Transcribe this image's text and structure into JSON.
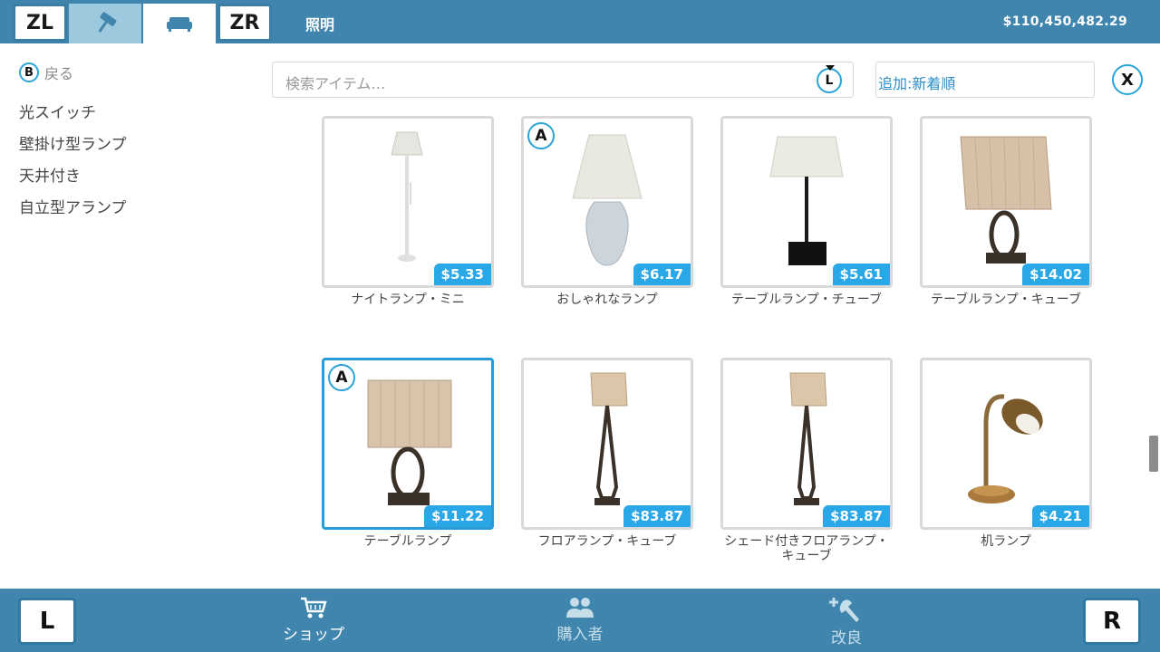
{
  "topbar": {
    "zl_label": "ZL",
    "zr_label": "ZR",
    "paint_tab_icon": "paint-roller-icon",
    "furniture_tab_icon": "sofa-icon",
    "category": "照明",
    "money": "$110,450,482.29"
  },
  "sidebar": {
    "back_button": "B",
    "back_label": "戻る",
    "items": [
      {
        "label": "光スイッチ"
      },
      {
        "label": "壁掛け型ランプ"
      },
      {
        "label": "天井付き"
      },
      {
        "label": "自立型アランプ"
      }
    ]
  },
  "search": {
    "placeholder": "検索アイテム…",
    "button": "L"
  },
  "sort": {
    "label": "追加:新着順"
  },
  "close_button": "X",
  "items": [
    {
      "name": "ナイトランプ・ミニ",
      "price": "$5.33",
      "badge": ""
    },
    {
      "name": "おしゃれなランプ",
      "price": "$6.17",
      "badge": "A"
    },
    {
      "name": "テーブルランプ・チューブ",
      "price": "$5.61",
      "badge": ""
    },
    {
      "name": "テーブルランプ・キューブ",
      "price": "$14.02",
      "badge": ""
    },
    {
      "name": "テーブルランプ",
      "price": "$11.22",
      "badge": "A"
    },
    {
      "name": "フロアランプ・キューブ",
      "price": "$83.87",
      "badge": ""
    },
    {
      "name": "シェード付きフロアランプ・キューブ",
      "price": "$83.87",
      "badge": ""
    },
    {
      "name": "机ランプ",
      "price": "$4.21",
      "badge": ""
    }
  ],
  "bottombar": {
    "l_label": "L",
    "r_label": "R",
    "shop": {
      "label": "ショップ",
      "icon": "cart-icon"
    },
    "buyers": {
      "label": "購入者",
      "icon": "people-icon"
    },
    "upgrade": {
      "label": "改良",
      "icon": "wrench-plus-icon"
    }
  },
  "colors": {
    "bar": "#3f85ad",
    "accent": "#29a7e6",
    "selected_border": "#2a9ad6"
  }
}
